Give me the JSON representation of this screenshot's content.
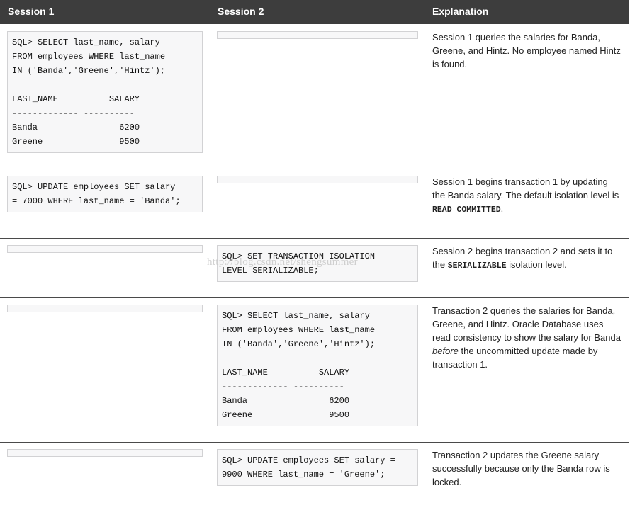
{
  "headers": {
    "session1": "Session 1",
    "session2": "Session 2",
    "explanation": "Explanation"
  },
  "rows": [
    {
      "s1_code": "SQL> SELECT last_name, salary\nFROM employees WHERE last_name\nIN ('Banda','Greene','Hintz');\n\nLAST_NAME          SALARY\n------------- ----------\nBanda                6200\nGreene               9500",
      "s2_code": "",
      "explanation": "Session 1 queries the salaries for Banda, Greene, and Hintz. No employee named Hintz is found."
    },
    {
      "s1_code": "SQL> UPDATE employees SET salary\n= 7000 WHERE last_name = 'Banda';",
      "s2_code": "",
      "explanation_before": "Session 1 begins transaction 1 by updating the Banda salary. The default isolation level is ",
      "explanation_code": "READ COMMITTED",
      "explanation_after": "."
    },
    {
      "s1_code": "",
      "s2_code": "SQL> SET TRANSACTION ISOLATION\nLEVEL SERIALIZABLE;",
      "explanation_before": "Session 2 begins transaction 2 and sets it to the ",
      "explanation_code": "SERIALIZABLE",
      "explanation_after": " isolation level."
    },
    {
      "s1_code": "",
      "s2_code": "SQL> SELECT last_name, salary\nFROM employees WHERE last_name\nIN ('Banda','Greene','Hintz');\n\nLAST_NAME          SALARY\n------------- ----------\nBanda                6200\nGreene               9500",
      "explanation_before": "Transaction 2 queries the salaries for Banda, Greene, and Hintz. Oracle Database uses read consistency to show the salary for Banda ",
      "explanation_em": "before",
      "explanation_after": " the uncommitted update made by transaction 1."
    },
    {
      "s1_code": "",
      "s2_code": "SQL> UPDATE employees SET salary =\n9900 WHERE last_name = 'Greene';",
      "explanation": "Transaction 2 updates the Greene salary successfully because only the Banda row is locked."
    }
  ],
  "watermark": "http://blog.csdn.net/shengsummer"
}
